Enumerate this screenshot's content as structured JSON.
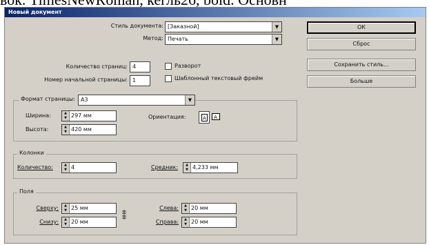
{
  "background_text": "вок. TimesNewRoman, кегль26, bold. Основн",
  "window": {
    "title": "Новый документ"
  },
  "doc": {
    "style_label": "Стиль документа:",
    "style_value": "[Заказной]",
    "method_label": "Метод:",
    "method_value": "Печать",
    "pages_label": "Количество страниц:",
    "pages_value": "4",
    "start_label": "Номер начальной страницы:",
    "start_value": "1",
    "spread_label": "Разворот",
    "frame_label": "Шаблонный текстовый фрейм"
  },
  "format": {
    "label": "Формат страницы:",
    "value": "А3",
    "width_label": "Ширина:",
    "width_value": "297 мм",
    "height_label": "Высота:",
    "height_value": "420 мм",
    "orient_label": "Ориентация:"
  },
  "columns": {
    "title": "Колонки",
    "count_label": "Количество:",
    "count_value": "4",
    "gutter_label": "Средник:",
    "gutter_value": "4,233 мм"
  },
  "margins": {
    "title": "Поля",
    "top_label": "Сверху:",
    "top_value": "25 мм",
    "bottom_label": "Снизу:",
    "bottom_value": "20 мм",
    "left_label": "Слева:",
    "left_value": "20 мм",
    "right_label": "Справа:",
    "right_value": "20 мм"
  },
  "buttons": {
    "ok": "ОК",
    "reset": "Сброс",
    "save_style": "Сохранить стиль...",
    "more": "Больше"
  }
}
